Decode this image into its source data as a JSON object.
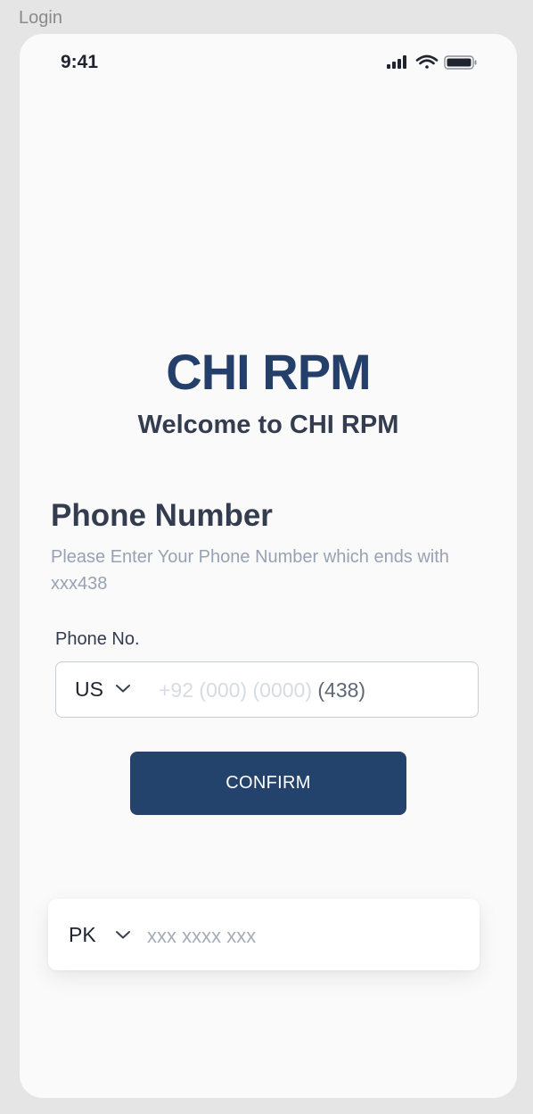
{
  "frame_label": "Login",
  "status_bar": {
    "time": "9:41",
    "icons": [
      "signal-icon",
      "wifi-icon",
      "battery-icon"
    ]
  },
  "brand": {
    "title": "CHI RPM",
    "welcome": "Welcome to CHI RPM"
  },
  "phone_section": {
    "title": "Phone Number",
    "description": "Please Enter Your Phone Number which ends with xxx438",
    "field_label": "Phone No.",
    "country_code": "US",
    "placeholder_prefix": "+92 (000) (0000) ",
    "placeholder_suffix": "(438)"
  },
  "confirm_button": {
    "label": "CONFIRM"
  },
  "secondary_field": {
    "country_code": "PK",
    "placeholder": "xxx xxxx xxx"
  },
  "colors": {
    "brand": "#24406a",
    "button": "#24436c",
    "text_dark": "#343c50",
    "text_muted": "#98a2b3"
  }
}
